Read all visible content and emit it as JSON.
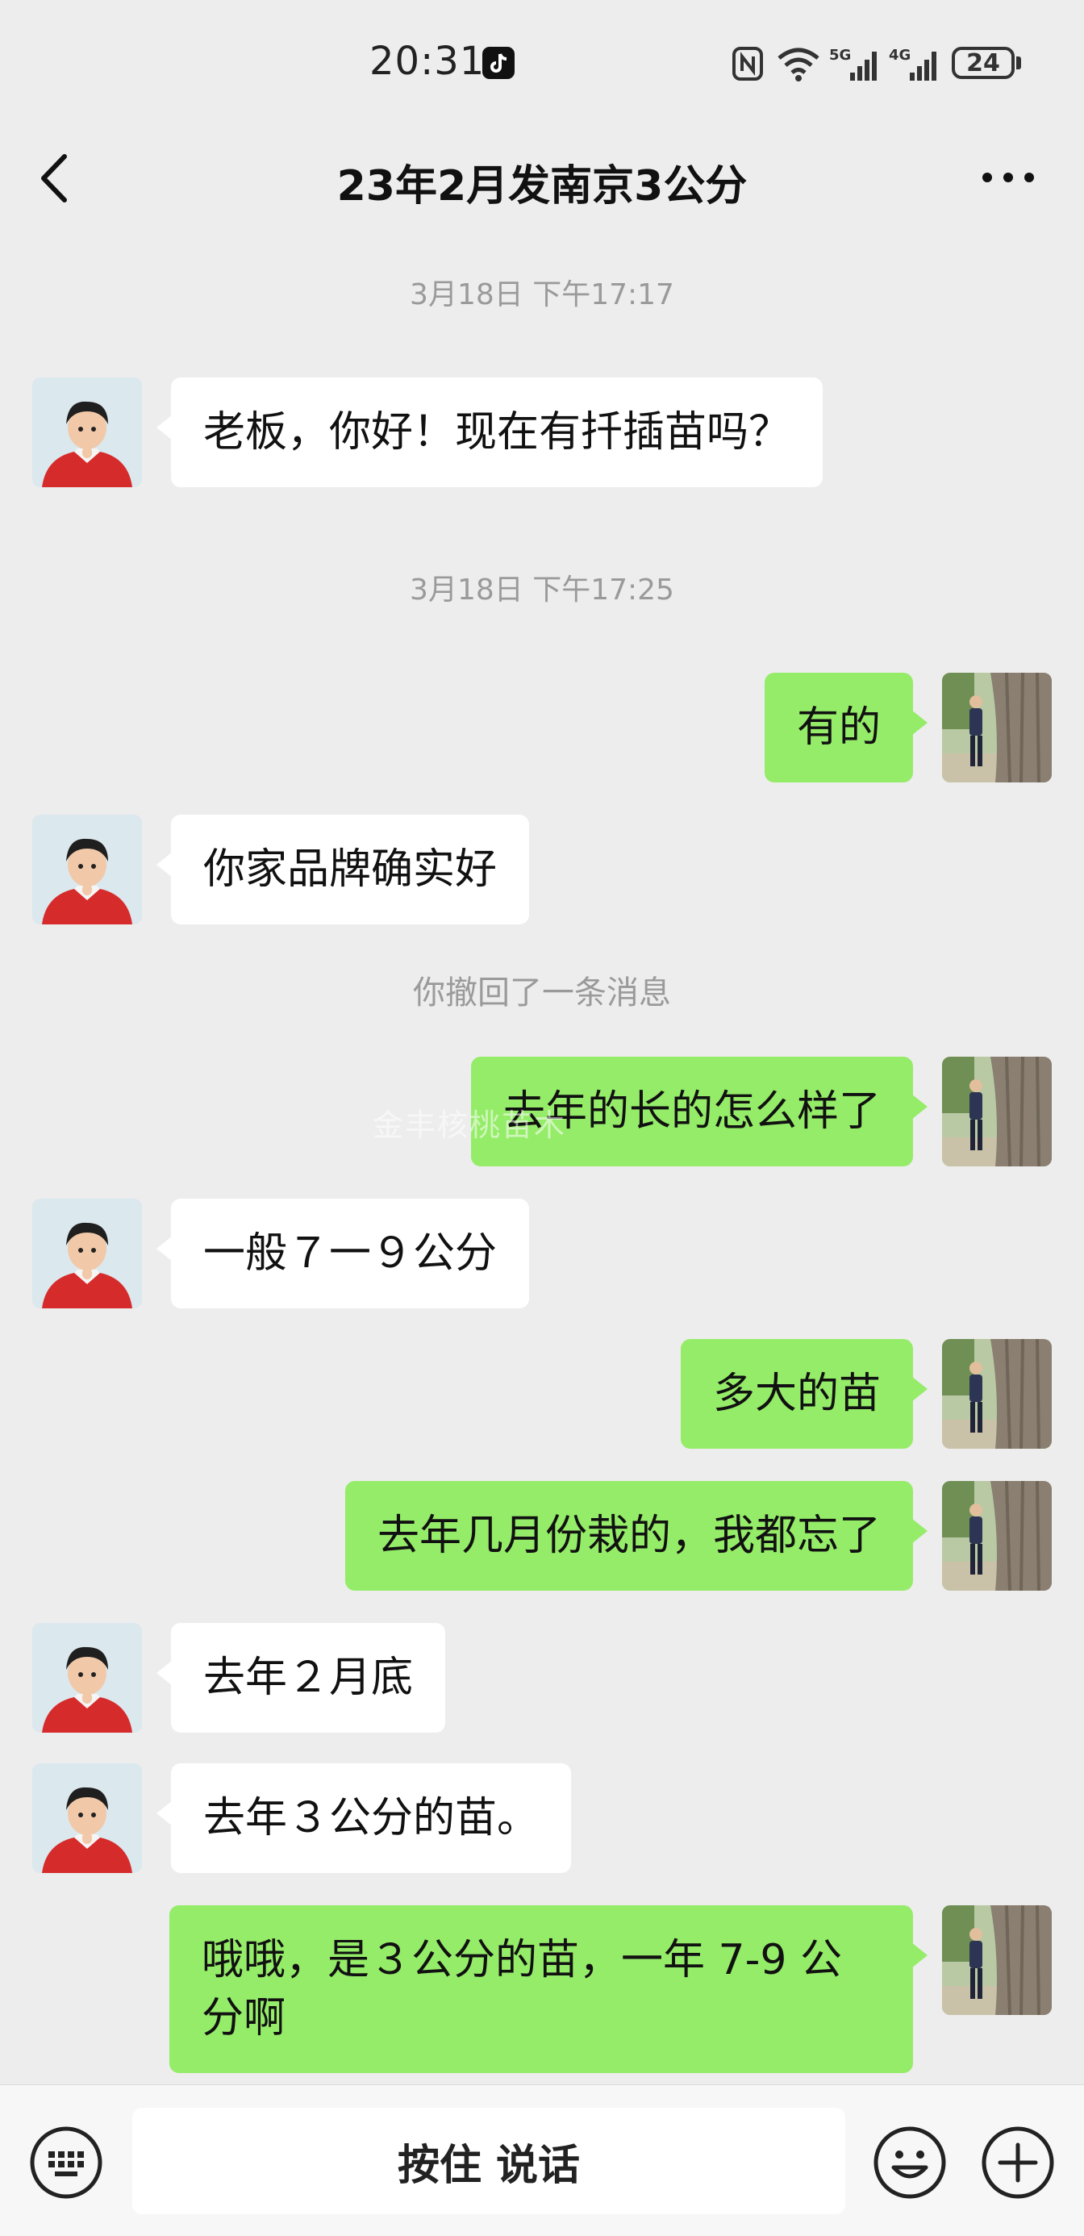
{
  "status_bar": {
    "time": "20:31",
    "battery": "24",
    "icons": [
      "tiktok-icon",
      "nfc-icon",
      "wifi-icon",
      "5g-signal-icon",
      "4g-signal-icon",
      "battery-icon"
    ],
    "network_5g": "5G",
    "network_4g": "4G"
  },
  "header": {
    "title": "23年2月发南京3公分",
    "back_icon": "chevron-left-icon",
    "more_icon": "more-horizontal-icon"
  },
  "messages": [
    {
      "type": "time",
      "text": "3月18日 下午17:17"
    },
    {
      "type": "msg",
      "side": "left",
      "text": "老板，你好！现在有扦插苗吗？"
    },
    {
      "type": "time",
      "text": "3月18日 下午17:25"
    },
    {
      "type": "msg",
      "side": "right",
      "text": "有的"
    },
    {
      "type": "msg",
      "side": "left",
      "text": "你家品牌确实好"
    },
    {
      "type": "system",
      "text": "你撤回了一条消息"
    },
    {
      "type": "msg",
      "side": "right",
      "text": "去年的长的怎么样了"
    },
    {
      "type": "msg",
      "side": "left",
      "text": "一般７一９公分"
    },
    {
      "type": "msg",
      "side": "right",
      "text": "多大的苗"
    },
    {
      "type": "msg",
      "side": "right",
      "text": "去年几月份栽的，我都忘了"
    },
    {
      "type": "msg",
      "side": "left",
      "text": "去年２月底"
    },
    {
      "type": "msg",
      "side": "left",
      "text": "去年３公分的苗。"
    },
    {
      "type": "msg",
      "side": "right",
      "text": "哦哦，是３公分的苗，一年 7-9 公分啊"
    }
  ],
  "watermark": "金丰核桃苗木",
  "input_bar": {
    "hold_to_talk": "按住 说话",
    "keyboard_icon": "keyboard-icon",
    "emoji_icon": "emoji-icon",
    "plus_icon": "plus-circle-icon"
  },
  "colors": {
    "background": "#ededed",
    "bubble_sent": "#95ec69",
    "bubble_received": "#ffffff",
    "meta_text": "#9a9a9a"
  }
}
